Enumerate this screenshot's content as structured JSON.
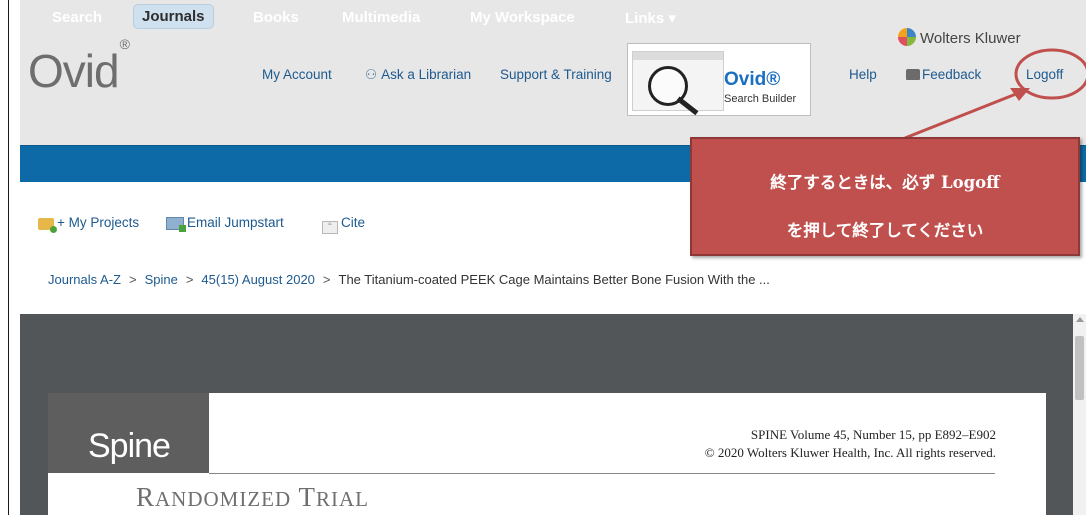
{
  "header": {
    "logo": "Ovid",
    "logo_mark": "®",
    "links": {
      "my_account": "My Account",
      "ask_librarian": "Ask a Librarian",
      "support_training": "Support & Training",
      "help": "Help",
      "feedback": "Feedback",
      "logoff": "Logoff"
    },
    "brand": "Wolters Kluwer",
    "promo": {
      "title": "Ovid®",
      "subtitle": "Search Builder"
    }
  },
  "nav": {
    "items": [
      "Search",
      "Journals",
      "Books",
      "Multimedia",
      "My Workspace",
      "Links ▾"
    ],
    "active": "Journals"
  },
  "toolbar": {
    "my_projects": "+ My Projects",
    "email_jumpstart": "Email Jumpstart",
    "cite": "Cite"
  },
  "breadcrumb": {
    "items": [
      "Journals A-Z",
      "Spine",
      "45(15) August 2020"
    ],
    "separator": ">",
    "current": "The Titanium-coated PEEK Cage Maintains Better Bone Fusion With the ..."
  },
  "document": {
    "journal": "Spine",
    "citation_line1": "SPINE Volume 45, Number 15, pp E892–E902",
    "citation_line2": "© 2020 Wolters Kluwer Health, Inc. All rights reserved.",
    "section_title": "Randomized Trial"
  },
  "annotation": {
    "line1": "終了するときは、必ず Logoff",
    "line2": "を押して終了してください",
    "color": "#c0504d"
  }
}
